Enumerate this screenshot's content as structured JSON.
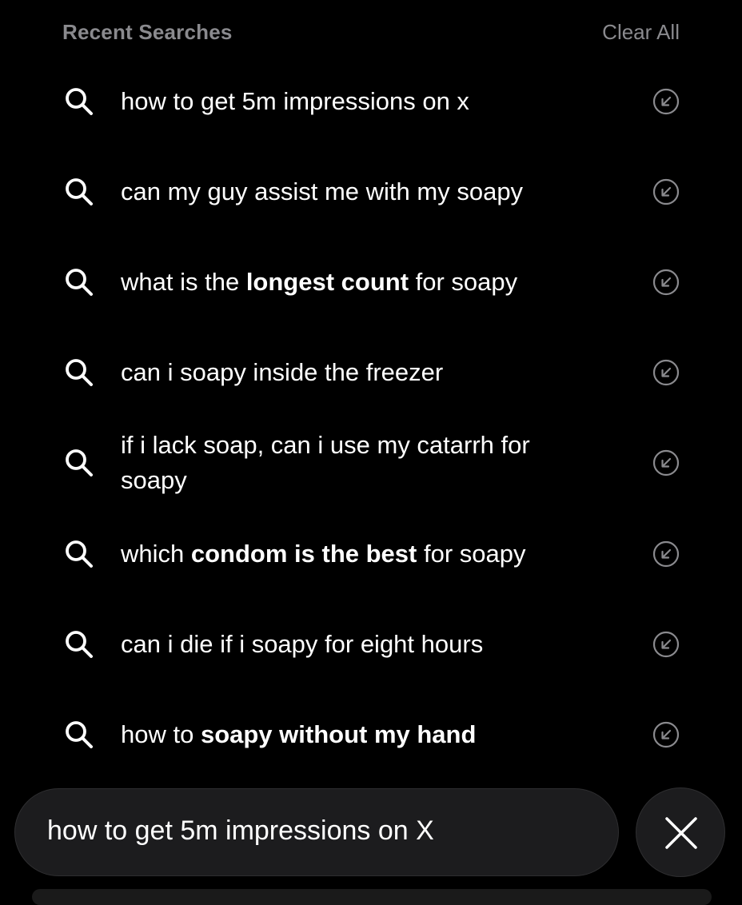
{
  "header": {
    "title": "Recent Searches",
    "clear_label": "Clear All"
  },
  "recent_searches": [
    {
      "segments": [
        {
          "text": "how to get 5m impressions on x",
          "bold": false
        }
      ]
    },
    {
      "segments": [
        {
          "text": "can my guy assist me with my soapy",
          "bold": false
        }
      ]
    },
    {
      "segments": [
        {
          "text": "what is the ",
          "bold": false
        },
        {
          "text": "longest count",
          "bold": true
        },
        {
          "text": " for soapy",
          "bold": false
        }
      ]
    },
    {
      "segments": [
        {
          "text": "can i soapy inside the freezer",
          "bold": false
        }
      ]
    },
    {
      "segments": [
        {
          "text": "if i lack soap, can i use my catarrh for soapy",
          "bold": false
        }
      ]
    },
    {
      "segments": [
        {
          "text": "which ",
          "bold": false
        },
        {
          "text": "condom is the best",
          "bold": true
        },
        {
          "text": " for soapy",
          "bold": false
        }
      ]
    },
    {
      "segments": [
        {
          "text": "can i die if i soapy for eight hours",
          "bold": false
        }
      ]
    },
    {
      "segments": [
        {
          "text": "how to ",
          "bold": false
        },
        {
          "text": "soapy without my hand",
          "bold": true
        }
      ]
    }
  ],
  "icons": {
    "search": "search-icon",
    "fill": "arrow-up-left-circle-icon",
    "close": "close-icon"
  },
  "search_field": {
    "value": "how to get 5m impressions on X"
  },
  "colors": {
    "background": "#000000",
    "text": "#ffffff",
    "muted": "#8a8a8e",
    "field_bg": "#1c1c1e"
  }
}
